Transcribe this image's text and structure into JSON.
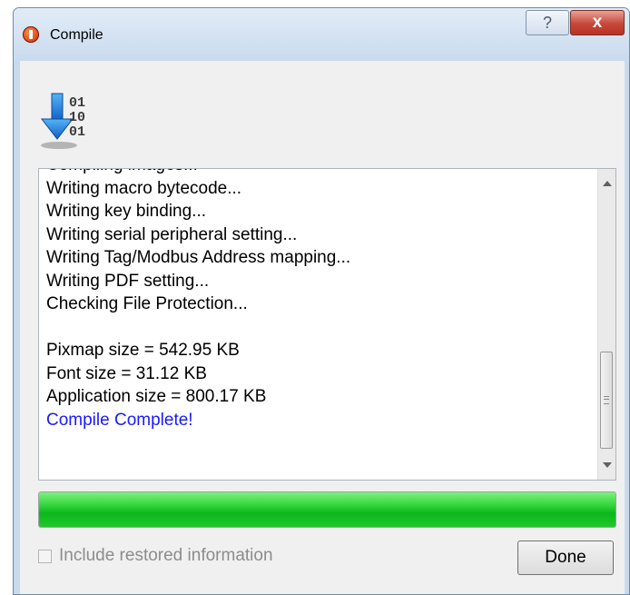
{
  "window": {
    "title": "Compile",
    "help_label": "?",
    "close_label": "x"
  },
  "log": {
    "lines": [
      {
        "text": "Compiling images...",
        "color": "#000000"
      },
      {
        "text": "Writing macro bytecode...",
        "color": "#000000"
      },
      {
        "text": "Writing key binding...",
        "color": "#000000"
      },
      {
        "text": "Writing serial peripheral setting...",
        "color": "#000000"
      },
      {
        "text": "Writing Tag/Modbus Address mapping...",
        "color": "#000000"
      },
      {
        "text": "Writing PDF setting...",
        "color": "#000000"
      },
      {
        "text": "Checking File Protection...",
        "color": "#000000"
      },
      {
        "text": "",
        "color": "#000000"
      },
      {
        "text": "Pixmap size = 542.95 KB",
        "color": "#000000"
      },
      {
        "text": "Font size = 31.12 KB",
        "color": "#000000"
      },
      {
        "text": "Application size = 800.17 KB",
        "color": "#000000"
      },
      {
        "text": "Compile Complete!",
        "color": "#1a1aff"
      }
    ]
  },
  "progress": {
    "value_percent": 100,
    "color": "#0bb71b"
  },
  "options": {
    "include_restored_label": "Include restored information",
    "include_restored_checked": false
  },
  "actions": {
    "done_label": "Done"
  },
  "icons": {
    "app": "app-logo-icon",
    "compile": "compile-download-icon",
    "binary_text": [
      "01",
      "10",
      "01"
    ]
  }
}
